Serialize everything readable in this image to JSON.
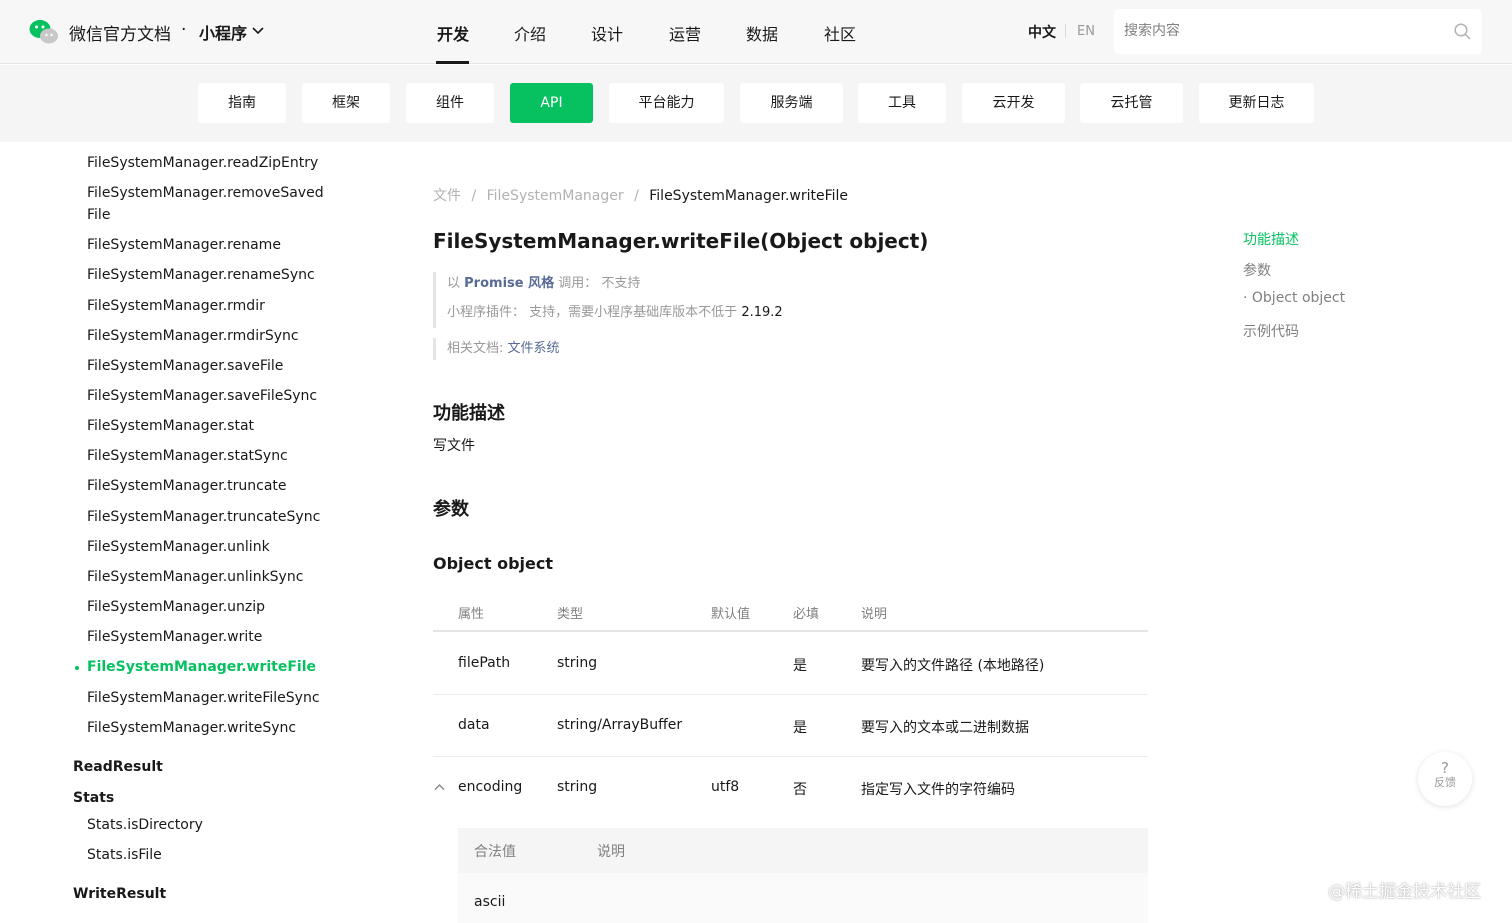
{
  "header": {
    "brand": "微信官方文档",
    "separator": "·",
    "product": "小程序",
    "nav": [
      "开发",
      "介绍",
      "设计",
      "运营",
      "数据",
      "社区"
    ],
    "active_nav": "开发",
    "lang_zh": "中文",
    "lang_en": "EN",
    "search_placeholder": "搜索内容"
  },
  "subnav": {
    "tabs": [
      "指南",
      "框架",
      "组件",
      "API",
      "平台能力",
      "服务端",
      "工具",
      "云开发",
      "云托管",
      "更新日志"
    ],
    "active": "API"
  },
  "sidebar": {
    "items": [
      "FileSystemManager.readZipEntry",
      "FileSystemManager.removeSaved File",
      "FileSystemManager.rename",
      "FileSystemManager.renameSync",
      "FileSystemManager.rmdir",
      "FileSystemManager.rmdirSync",
      "FileSystemManager.saveFile",
      "FileSystemManager.saveFileSync",
      "FileSystemManager.stat",
      "FileSystemManager.statSync",
      "FileSystemManager.truncate",
      "FileSystemManager.truncateSync",
      "FileSystemManager.unlink",
      "FileSystemManager.unlinkSync",
      "FileSystemManager.unzip",
      "FileSystemManager.write",
      "FileSystemManager.writeFile",
      "FileSystemManager.writeFileSync",
      "FileSystemManager.writeSync"
    ],
    "active_item": "FileSystemManager.writeFile",
    "groups": [
      {
        "label": "ReadResult",
        "children": []
      },
      {
        "label": "Stats",
        "children": [
          "Stats.isDirectory",
          "Stats.isFile"
        ]
      },
      {
        "label": "WriteResult",
        "children": []
      }
    ]
  },
  "main": {
    "breadcrumb": [
      "文件",
      "/",
      "FileSystemManager",
      "/",
      "FileSystemManager.writeFile"
    ],
    "title": "FileSystemManager.writeFile(Object object)",
    "promise_prefix": "以",
    "promise_link": "Promise 风格",
    "promise_mid": "调用：",
    "promise_value": "不支持",
    "plugin_label": "小程序插件：",
    "plugin_text": "支持，需要小程序基础库版本不低于",
    "plugin_version": "2.19.2",
    "related_label": "相关文档:",
    "related_link": "文件系统",
    "section_desc": "功能描述",
    "desc_text": "写文件",
    "section_params": "参数",
    "object_heading": "Object object",
    "table": {
      "headers": [
        "属性",
        "类型",
        "默认值",
        "必填",
        "说明"
      ],
      "rows": [
        {
          "name": "filePath",
          "type": "string",
          "default": "",
          "required": "是",
          "desc": "要写入的文件路径 (本地路径)"
        },
        {
          "name": "data",
          "type": "string/ArrayBuffer",
          "default": "",
          "required": "是",
          "desc": "要写入的文本或二进制数据"
        },
        {
          "name": "encoding",
          "type": "string",
          "default": "utf8",
          "required": "否",
          "desc": "指定写入文件的字符编码"
        }
      ]
    },
    "subtable": {
      "headers": [
        "合法值",
        "说明"
      ],
      "rows": [
        {
          "value": "ascii",
          "desc": ""
        }
      ]
    }
  },
  "toc": {
    "items": [
      "功能描述",
      "参数",
      "· Object object",
      "示例代码"
    ],
    "active": "功能描述"
  },
  "feedback": {
    "icon": "?",
    "label": "反馈"
  },
  "watermark": "@稀土掘金技术社区",
  "colors": {
    "accent": "#07c160",
    "link": "#576b95"
  }
}
